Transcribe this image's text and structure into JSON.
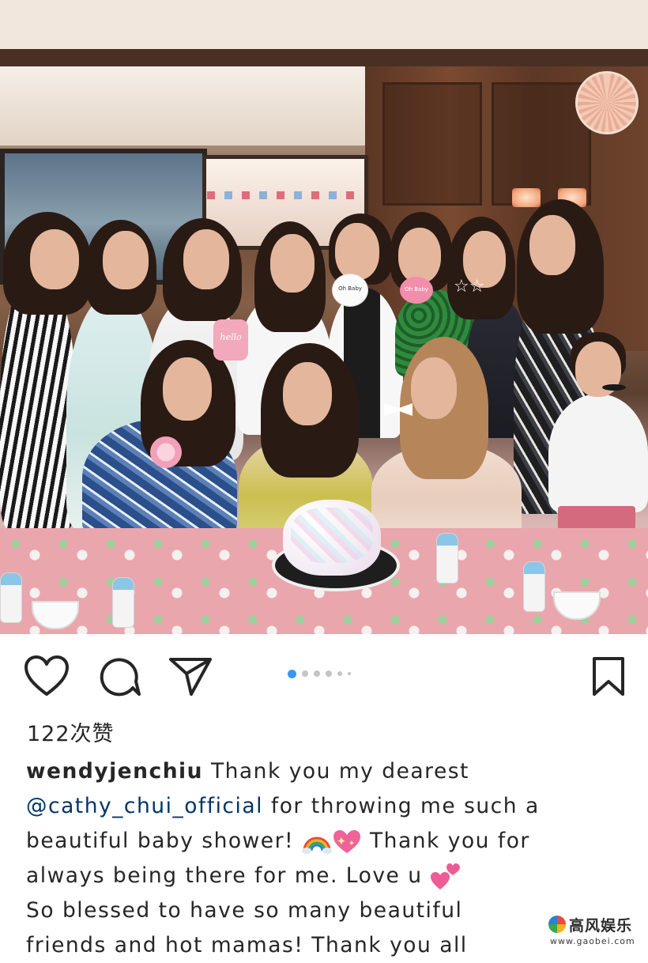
{
  "post": {
    "photo": {
      "description_icon": "group-photo-image",
      "props": {
        "onesie_sign": "hello",
        "bib_sign": "Oh Baby",
        "speech_bubble_sign": "Oh Baby"
      }
    },
    "actions": {
      "like_icon": "heart-outline-icon",
      "comment_icon": "comment-bubble-icon",
      "share_icon": "paper-plane-icon",
      "save_icon": "bookmark-outline-icon"
    },
    "carousel": {
      "total_dots": 6,
      "active_index": 0
    },
    "likes_text": "122次赞",
    "caption": {
      "username": "wendyjenchiu",
      "line1_text": " Thank you my dearest",
      "mention": "@cathy_chui_official",
      "line2_text": " for throwing me such a",
      "line3_text": "beautiful baby shower! ",
      "line3_after": " Thank you for",
      "line4_text": "always being there for me. Love u ",
      "line5_text": "So blessed to have so many beautiful",
      "line6_text": "friends and hot mamas! Thank you all"
    },
    "emojis": {
      "rainbow": "rainbow-emoji",
      "sparkling_heart": "sparkling-heart-emoji",
      "two_hearts": "two-hearts-emoji"
    }
  },
  "watermark": {
    "title": "高风娱乐",
    "url": "www.gaobei.com"
  },
  "colors": {
    "text": "#262626",
    "mention": "#003569",
    "carousel_active": "#3897f0",
    "carousel_inactive": "#c4c4c4"
  }
}
